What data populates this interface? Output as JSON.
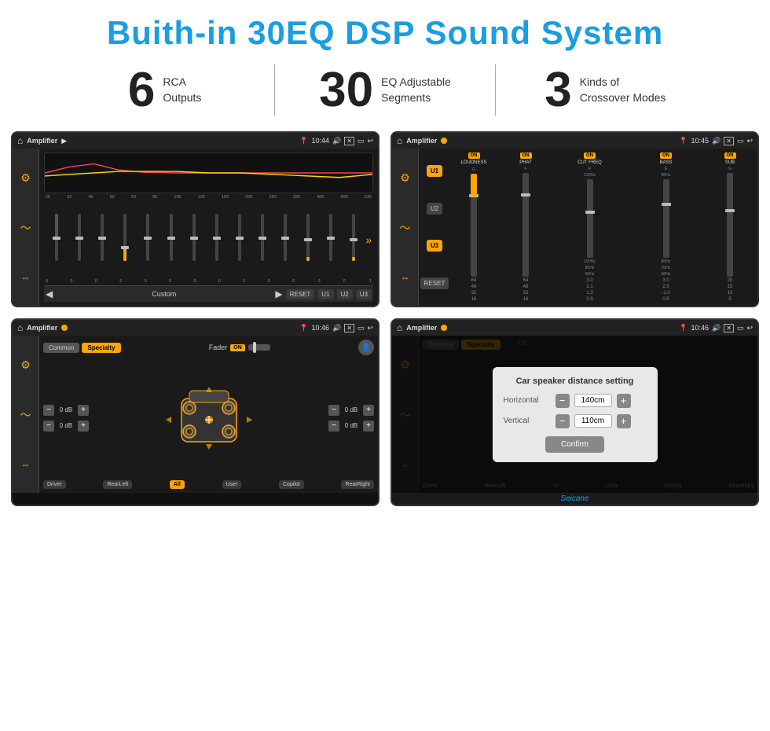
{
  "header": {
    "title": "Buith-in 30EQ DSP Sound System"
  },
  "stats": [
    {
      "number": "6",
      "text": "RCA\nOutputs"
    },
    {
      "number": "30",
      "text": "EQ Adjustable\nSegments"
    },
    {
      "number": "3",
      "text": "Kinds of\nCrossover Modes"
    }
  ],
  "screens": [
    {
      "id": "screen1",
      "status_bar": {
        "app_title": "Amplifier",
        "time": "10:44"
      },
      "type": "eq"
    },
    {
      "id": "screen2",
      "status_bar": {
        "app_title": "Amplifier",
        "time": "10:45"
      },
      "type": "amp_channels"
    },
    {
      "id": "screen3",
      "status_bar": {
        "app_title": "Amplifier",
        "time": "10:46"
      },
      "type": "fader"
    },
    {
      "id": "screen4",
      "status_bar": {
        "app_title": "Amplifier",
        "time": "10:46"
      },
      "type": "distance_dialog",
      "dialog": {
        "title": "Car speaker distance setting",
        "horizontal_label": "Horizontal",
        "horizontal_value": "140cm",
        "vertical_label": "Vertical",
        "vertical_value": "110cm",
        "confirm_label": "Confirm"
      }
    }
  ],
  "eq_screen": {
    "freq_labels": [
      "25",
      "32",
      "40",
      "50",
      "63",
      "80",
      "100",
      "125",
      "160",
      "200",
      "250",
      "320",
      "400",
      "500",
      "630"
    ],
    "values": [
      "0",
      "0",
      "0",
      "5",
      "0",
      "0",
      "0",
      "0",
      "0",
      "0",
      "0",
      "-1",
      "0",
      "-1"
    ],
    "buttons": [
      "RESET",
      "U1",
      "U2",
      "U3"
    ],
    "custom_label": "Custom"
  },
  "amp_screen": {
    "presets": [
      "U1",
      "U2",
      "U3",
      "RESET"
    ],
    "channels": [
      {
        "toggle": "ON",
        "label": "LOUDNESS"
      },
      {
        "toggle": "ON",
        "label": "PHAT"
      },
      {
        "toggle": "ON",
        "label": "CUT FREQ"
      },
      {
        "toggle": "ON",
        "label": "BASS"
      },
      {
        "toggle": "ON",
        "label": "SUB"
      }
    ]
  },
  "fader_screen": {
    "tabs": [
      "Common",
      "Specialty"
    ],
    "fader_label": "Fader",
    "on_label": "ON",
    "db_values": [
      "0 dB",
      "0 dB",
      "0 dB",
      "0 dB"
    ],
    "bottom_btns": [
      "Driver",
      "RearLeft",
      "All",
      "User",
      "Copilot",
      "RearRight"
    ]
  },
  "distance_dialog": {
    "title": "Car speaker distance setting",
    "horizontal_label": "Horizontal",
    "horizontal_value": "140cm",
    "vertical_label": "Vertical",
    "vertical_value": "110cm",
    "confirm_label": "Confirm"
  },
  "watermark": "Seicane"
}
